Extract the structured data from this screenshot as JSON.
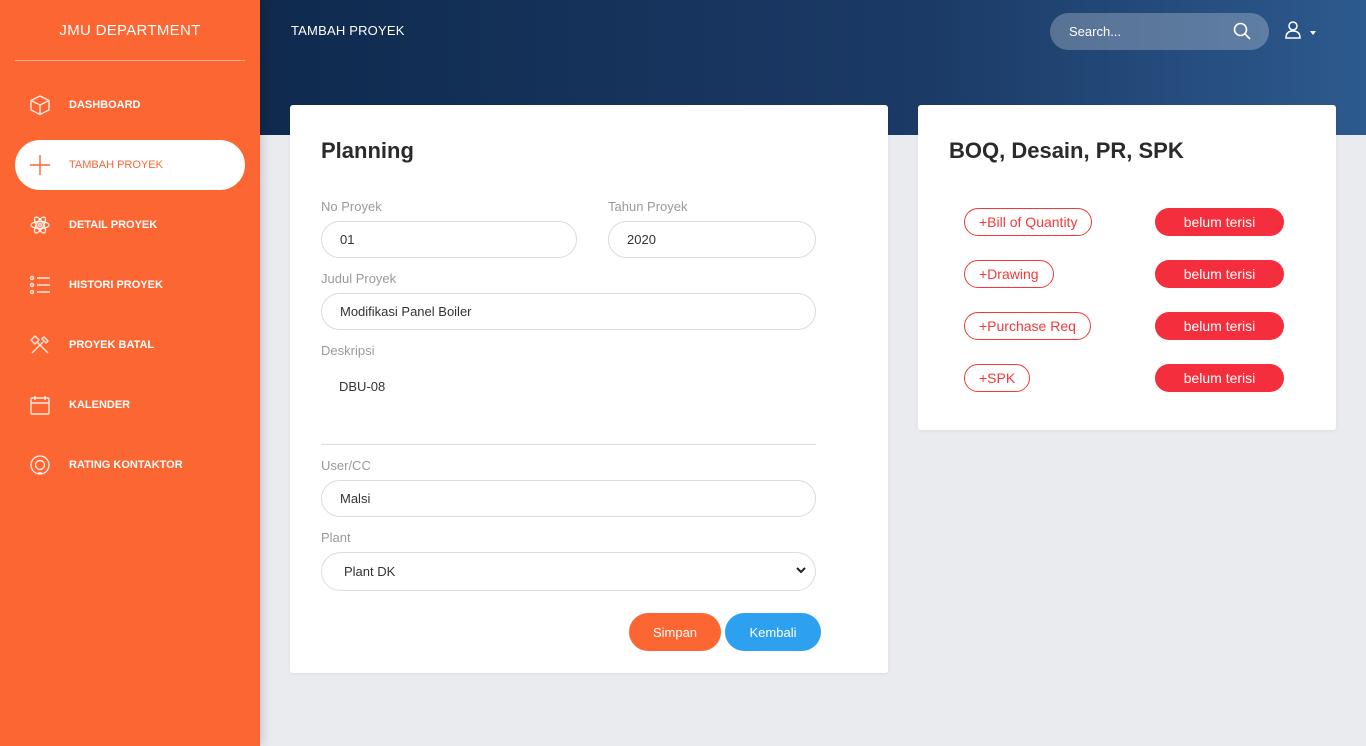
{
  "sidebar": {
    "brand": "JMU DEPARTMENT",
    "items": [
      {
        "label": "DASHBOARD",
        "icon": "box-icon"
      },
      {
        "label": "TAMBAH PROYEK",
        "icon": "plus-icon"
      },
      {
        "label": "DETAIL PROYEK",
        "icon": "atom-icon"
      },
      {
        "label": "HISTORI PROYEK",
        "icon": "list-icon"
      },
      {
        "label": "PROYEK BATAL",
        "icon": "tools-icon"
      },
      {
        "label": "KALENDER",
        "icon": "calendar-icon"
      },
      {
        "label": "RATING KONTAKTOR",
        "icon": "badge-icon"
      }
    ]
  },
  "header": {
    "title": "TAMBAH PROYEK",
    "search_placeholder": "Search..."
  },
  "planning": {
    "title": "Planning",
    "no_proyek_label": "No Proyek",
    "no_proyek_value": "01",
    "tahun_label": "Tahun Proyek",
    "tahun_value": "2020",
    "judul_label": "Judul Proyek",
    "judul_value": "Modifikasi Panel Boiler",
    "deskripsi_label": "Deskripsi",
    "deskripsi_value": "DBU-08",
    "user_label": "User/CC",
    "user_value": "Malsi",
    "plant_label": "Plant",
    "plant_value": "Plant DK",
    "simpan": "Simpan",
    "kembali": "Kembali"
  },
  "boq": {
    "title": "BOQ, Desain, PR, SPK",
    "rows": [
      {
        "link": "+Bill of Quantity",
        "status": "belum terisi"
      },
      {
        "link": "+Drawing",
        "status": "belum terisi"
      },
      {
        "link": "+Purchase Req",
        "status": "belum terisi"
      },
      {
        "link": "+SPK",
        "status": "belum terisi"
      }
    ]
  },
  "colors": {
    "sidebar": "#fb6633",
    "header_start": "#0f2a4e",
    "header_end": "#2d5a8e",
    "primary_button": "#fb6633",
    "secondary_button": "#2da1ef",
    "status_red": "#f42e3c"
  }
}
